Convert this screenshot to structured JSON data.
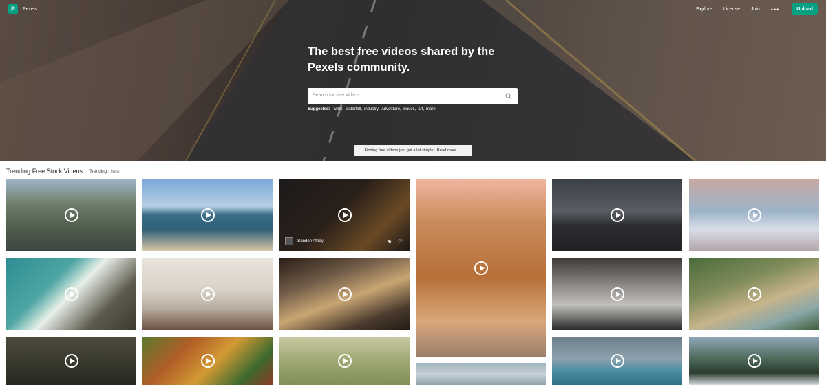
{
  "brand": {
    "name": "Pexels",
    "logo_letter": "P",
    "color": "#05a081"
  },
  "nav": {
    "links": [
      "Explore",
      "License",
      "Join"
    ],
    "more": "•••",
    "upload": "Upload"
  },
  "hero": {
    "headline": "The best free videos shared by the Pexels community.",
    "search_placeholder": "Search for free videos",
    "suggested_label": "Suggested:",
    "suggested": [
      "work,",
      "waterfall,",
      "industry,",
      "adventure,",
      "waves,",
      "art,",
      "more"
    ],
    "banner": "Finding free videos just got a lot simpler. Read more →"
  },
  "section": {
    "title": "Trending Free Stock Videos",
    "tab_active": "Trending",
    "separator": "|",
    "tab_inactive": "New"
  },
  "featured_tile": {
    "author": "brandon Athey",
    "icons": [
      "add-icon",
      "heart-icon"
    ]
  },
  "tiles": [
    {
      "name": "tile-city-traffic",
      "bg": "linear-gradient(180deg,#9fb5c7 0%,#6d7f6a 35%,#4e5b4a 70%,#3e4543 100%)"
    },
    {
      "name": "tile-beach-waves",
      "bg": "linear-gradient(180deg,#7aa7d8 0%,#b7cfe6 38%,#3d6f8a 50%,#2f5e75 70%,#d8c8a8 100%)"
    },
    {
      "name": "tile-night-fire",
      "bg": "linear-gradient(135deg,#1c1a1a 0%,#2a201a 45%,#6a4a25 75%,#1a1616 100%)"
    },
    {
      "name": "tile-coffee-flower",
      "bg": "linear-gradient(180deg,#f0b69f 0%,#c98a5a 25%,#b86f38 55%,#d9a77a 80%,#9c7f6c 100%)"
    },
    {
      "name": "tile-road-lines",
      "bg": "linear-gradient(180deg,#3b3f46 0%,#5a5d63 45%,#2b2d31 65%,#1f2124 100%)"
    },
    {
      "name": "tile-snow-sunset",
      "bg": "linear-gradient(180deg,#c7a7a2 0%,#9db3c8 45%,#d9dde8 70%,#b3a6a9 100%)"
    },
    {
      "name": "tile-ocean-aerial",
      "bg": "linear-gradient(135deg,#2f8c93 0%,#4ea6a3 35%,#e8efe9 50%,#5d5a4e 75%,#3c3a30 100%)"
    },
    {
      "name": "tile-woman-phone",
      "bg": "linear-gradient(180deg,#e9e4dd 0%,#d8d1c6 45%,#b9aea0 70%,#6b5040 100%)"
    },
    {
      "name": "tile-rocky-shore",
      "bg": "linear-gradient(160deg,#2a1e16 0%,#6e5a47 30%,#c9a573 55%,#4a3b2d 80%,#221a14 100%)"
    },
    {
      "name": "tile-laptop-typing",
      "bg": "linear-gradient(180deg,#3d3a38 0%,#9a9795 45%,#c2c0bd 65%,#2b2928 100%)"
    },
    {
      "name": "tile-boats-bay",
      "bg": "linear-gradient(160deg,#4a6b3a 0%,#7f8b5a 35%,#c7b48a 60%,#8aa7a8 80%,#3f5d3a 100%)"
    },
    {
      "name": "tile-dark-forest",
      "bg": "linear-gradient(180deg,#4d4a3c 0%,#3a3a2f 50%,#27281f 100%)"
    },
    {
      "name": "tile-autumn-forest",
      "bg": "linear-gradient(135deg,#5c7a2c 0%,#b05d27 30%,#d39a34 55%,#3e6a2f 80%,#8a3a25 100%)"
    },
    {
      "name": "tile-wheat-field",
      "bg": "linear-gradient(180deg,#c8c9a1 0%,#9fa873 50%,#7f8f55 100%)"
    },
    {
      "name": "tile-sea-foam",
      "bg": "linear-gradient(180deg,#a3b3bf 0%,#c6d1d8 50%,#8fa0ab 100%)"
    },
    {
      "name": "tile-basketball-court",
      "bg": "linear-gradient(180deg,#6b7d8a 0%,#8da2ae 45%,#4c8fa6 70%,#2f6f84 100%)"
    },
    {
      "name": "tile-waterfall",
      "bg": "linear-gradient(180deg,#8fa6b9 0%,#4d6a5a 45%,#2a3b2e 75%,#d6dbde 100%)"
    }
  ]
}
